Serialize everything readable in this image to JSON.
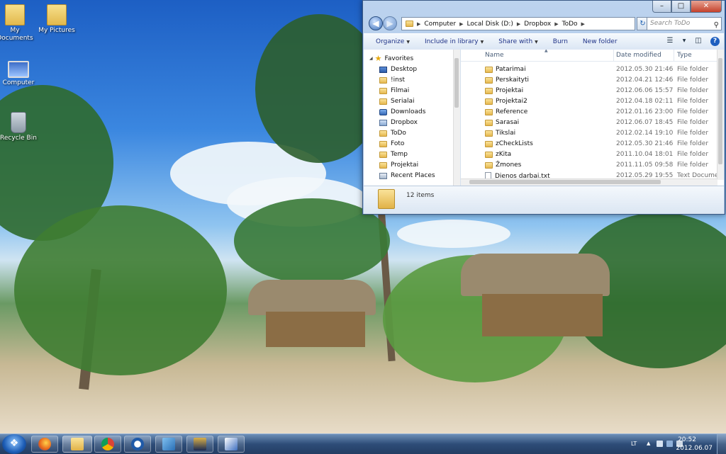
{
  "desktop": {
    "icons": [
      {
        "label": "My Documents"
      },
      {
        "label": "My Pictures"
      },
      {
        "label": "Computer"
      },
      {
        "label": "Recycle Bin"
      }
    ]
  },
  "window": {
    "address": {
      "segments": [
        "Computer",
        "Local Disk (D:)",
        "Dropbox",
        "ToDo"
      ]
    },
    "search_placeholder": "Search ToDo",
    "toolbar": {
      "organize": "Organize",
      "include": "Include in library",
      "share": "Share with",
      "burn": "Burn",
      "new_folder": "New folder"
    },
    "nav": {
      "favorites": "Favorites",
      "items": [
        "Desktop",
        "!inst",
        "Filmai",
        "Serialai",
        "Downloads",
        "Dropbox",
        "ToDo",
        "Foto",
        "Temp",
        "Projektai",
        "Recent Places"
      ]
    },
    "columns": {
      "name": "Name",
      "date": "Date modified",
      "type": "Type"
    },
    "files": [
      {
        "name": "Patarimai",
        "date": "2012.05.30 21:46",
        "type": "File folder"
      },
      {
        "name": "Perskaityti",
        "date": "2012.04.21 12:46",
        "type": "File folder"
      },
      {
        "name": "Projektai",
        "date": "2012.06.06 15:57",
        "type": "File folder"
      },
      {
        "name": "Projektai2",
        "date": "2012.04.18 02:11",
        "type": "File folder"
      },
      {
        "name": "Reference",
        "date": "2012.01.16 23:00",
        "type": "File folder"
      },
      {
        "name": "Sarasai",
        "date": "2012.06.07 18:45",
        "type": "File folder"
      },
      {
        "name": "Tikslai",
        "date": "2012.02.14 19:10",
        "type": "File folder"
      },
      {
        "name": "zCheckLists",
        "date": "2012.05.30 21:46",
        "type": "File folder"
      },
      {
        "name": "zKita",
        "date": "2011.10.04 18:01",
        "type": "File folder"
      },
      {
        "name": "Žmones",
        "date": "2011.11.05 09:58",
        "type": "File folder"
      },
      {
        "name": "Dienos darbai.txt",
        "date": "2012.05.29 19:55",
        "type": "Text Document"
      }
    ],
    "item_count": "12 items"
  },
  "taskbar": {
    "language": "LT",
    "time": "20:52",
    "date": "2012.06.07"
  },
  "colors": {
    "accent": "#1e3287",
    "taskbar": "#2e4d78",
    "close_button": "#c4412b"
  }
}
